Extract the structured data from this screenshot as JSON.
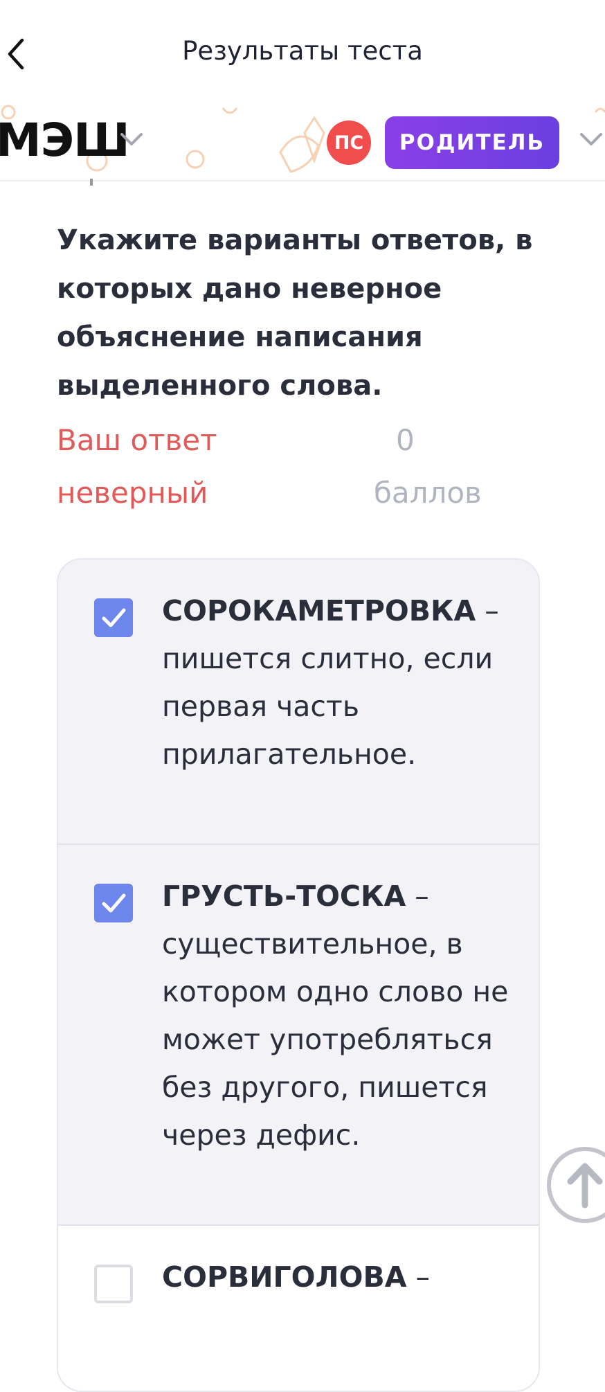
{
  "navbar": {
    "title": "Результаты теста"
  },
  "header": {
    "logo": "МЭШ",
    "avatar_initials": "ПС",
    "role": "РОДИТЕЛЬ"
  },
  "question": {
    "text": "Укажите варианты ответов, в которых дано неверное объяснение написания выделенного слова.",
    "verdict": "Ваш ответ неверный",
    "score_value": "0",
    "score_unit": "баллов"
  },
  "options": [
    {
      "word": "СОРОКАМЕТРОВКА",
      "dash": " – ",
      "explanation": "пишется слитно, если первая часть прилагательное.",
      "checked": true
    },
    {
      "word": "ГРУСТЬ-ТОСКА",
      "dash": " – ",
      "explanation": "существительное, в котором одно слово не может употребляться без другого, пишется через дефис.",
      "checked": true
    },
    {
      "word": "СОРВИГОЛОВА",
      "dash": " –",
      "explanation": "",
      "checked": false
    }
  ],
  "colors": {
    "accent": "#6c86ec",
    "error": "#e05a5a",
    "role_badge": "#7a3fe3",
    "avatar": "#f24d4d"
  }
}
